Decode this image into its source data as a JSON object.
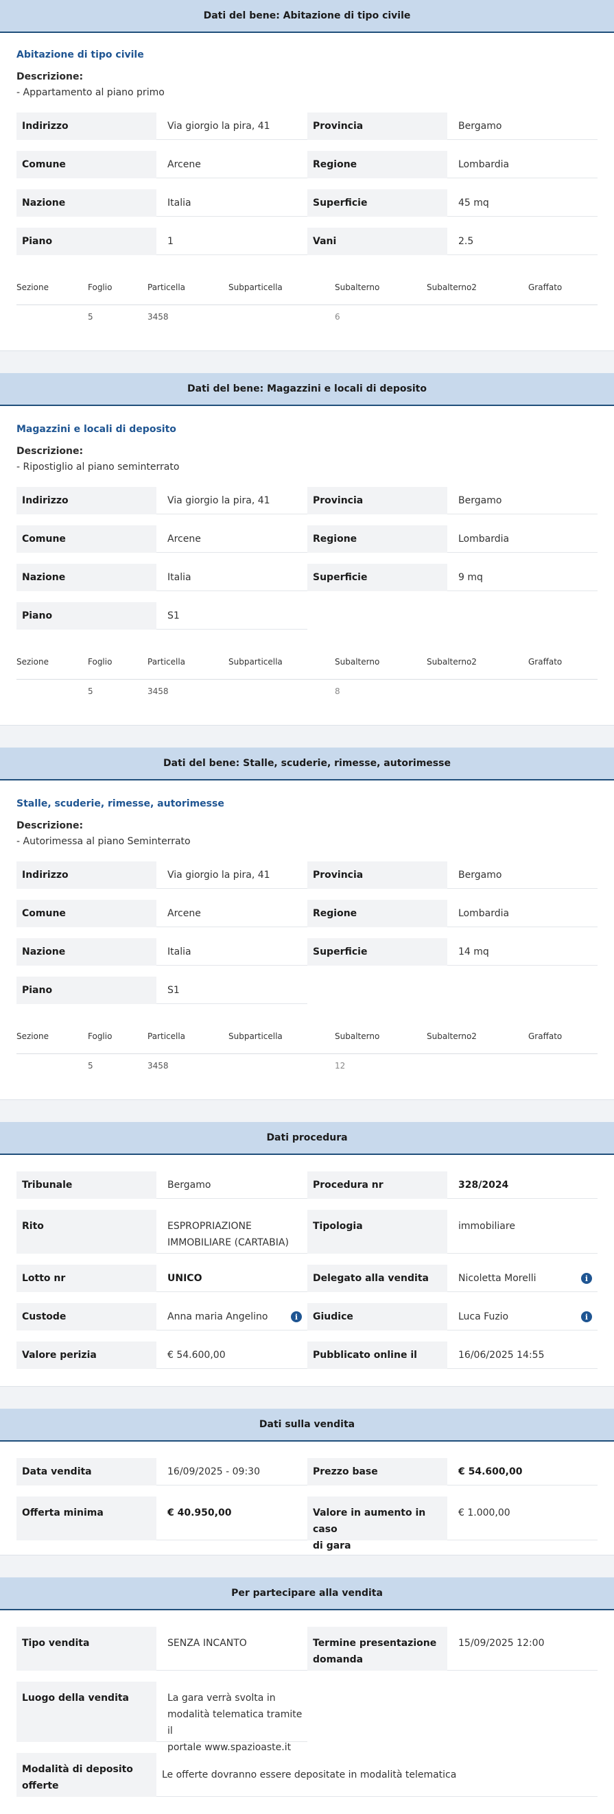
{
  "beni": [
    {
      "header": "Dati del bene: Abitazione di tipo civile",
      "subtitle": "Abitazione di tipo civile",
      "descrizione_label": "Descrizione:",
      "descrizione": "- Appartamento al piano primo",
      "indirizzo_label": "Indirizzo",
      "indirizzo": "Via giorgio la pira, 41",
      "provincia_label": "Provincia",
      "provincia": "Bergamo",
      "comune_label": "Comune",
      "comune": "Arcene",
      "regione_label": "Regione",
      "regione": "Lombardia",
      "nazione_label": "Nazione",
      "nazione": "Italia",
      "superficie_label": "Superficie",
      "superficie": "45 mq",
      "piano_label": "Piano",
      "piano": "1",
      "vani_label": "Vani",
      "vani": "2.5",
      "catasto": {
        "headers": [
          "Sezione",
          "Foglio",
          "Particella",
          "Subparticella",
          "Subalterno",
          "Subalterno2",
          "Graffato"
        ],
        "foglio": "5",
        "particella": "3458",
        "subalterno": "6"
      }
    },
    {
      "header": "Dati del bene: Magazzini e locali di deposito",
      "subtitle": "Magazzini e locali di deposito",
      "descrizione_label": "Descrizione:",
      "descrizione": "- Ripostiglio al piano seminterrato",
      "indirizzo_label": "Indirizzo",
      "indirizzo": "Via giorgio la pira, 41",
      "provincia_label": "Provincia",
      "provincia": "Bergamo",
      "comune_label": "Comune",
      "comune": "Arcene",
      "regione_label": "Regione",
      "regione": "Lombardia",
      "nazione_label": "Nazione",
      "nazione": "Italia",
      "superficie_label": "Superficie",
      "superficie": "9 mq",
      "piano_label": "Piano",
      "piano": "S1",
      "catasto": {
        "headers": [
          "Sezione",
          "Foglio",
          "Particella",
          "Subparticella",
          "Subalterno",
          "Subalterno2",
          "Graffato"
        ],
        "foglio": "5",
        "particella": "3458",
        "subalterno": "8"
      }
    },
    {
      "header": "Dati del bene: Stalle, scuderie, rimesse, autorimesse",
      "subtitle": "Stalle, scuderie, rimesse, autorimesse",
      "descrizione_label": "Descrizione:",
      "descrizione": "- Autorimessa al piano Seminterrato",
      "indirizzo_label": "Indirizzo",
      "indirizzo": "Via giorgio la pira, 41",
      "provincia_label": "Provincia",
      "provincia": "Bergamo",
      "comune_label": "Comune",
      "comune": "Arcene",
      "regione_label": "Regione",
      "regione": "Lombardia",
      "nazione_label": "Nazione",
      "nazione": "Italia",
      "superficie_label": "Superficie",
      "superficie": "14 mq",
      "piano_label": "Piano",
      "piano": "S1",
      "catasto": {
        "headers": [
          "Sezione",
          "Foglio",
          "Particella",
          "Subparticella",
          "Subalterno",
          "Subalterno2",
          "Graffato"
        ],
        "foglio": "5",
        "particella": "3458",
        "subalterno": "12"
      }
    }
  ],
  "procedura": {
    "header": "Dati procedura",
    "tribunale_label": "Tribunale",
    "tribunale": "Bergamo",
    "procedura_label": "Procedura nr",
    "procedura": "328/2024",
    "rito_label": "Rito",
    "rito_1": "ESPROPRIAZIONE",
    "rito_2": "IMMOBILIARE (CARTABIA)",
    "tipologia_label": "Tipologia",
    "tipologia": "immobiliare",
    "lotto_label": "Lotto nr",
    "lotto": "UNICO",
    "delegato_label": "Delegato alla vendita",
    "delegato": "Nicoletta Morelli",
    "custode_label": "Custode",
    "custode": "Anna maria Angelino",
    "giudice_label": "Giudice",
    "giudice": "Luca Fuzio",
    "perizia_label": "Valore perizia",
    "perizia": "€ 54.600,00",
    "pubblicato_label": "Pubblicato online il",
    "pubblicato": "16/06/2025 14:55",
    "info_glyph": "i"
  },
  "vendita": {
    "header": "Dati sulla vendita",
    "data_label": "Data vendita",
    "data": "16/09/2025 - 09:30",
    "prezzo_label": "Prezzo base",
    "prezzo": "€ 54.600,00",
    "offerta_label": "Offerta minima",
    "offerta": "€ 40.950,00",
    "aumento_label_1": "Valore in aumento in caso",
    "aumento_label_2": "di gara",
    "aumento": "€ 1.000,00"
  },
  "partecipare": {
    "header": "Per partecipare alla vendita",
    "tipo_label": "Tipo vendita",
    "tipo": "SENZA INCANTO",
    "termine_label_1": "Termine presentazione",
    "termine_label_2": "domanda",
    "termine": "15/09/2025 12:00",
    "luogo_label": "Luogo della vendita",
    "luogo_1": "La gara verrà svolta in",
    "luogo_2": "modalità telematica tramite il",
    "luogo_3": "portale www.spazioaste.it",
    "modalita_label_1": "Modalità di deposito",
    "modalita_label_2": "offerte",
    "modalita": "Le offerte dovranno essere depositate in modalità telematica"
  },
  "colors": {
    "header_bg": "#c8d9ec",
    "accent": "#1f5592",
    "label_bg": "#f2f3f5"
  }
}
